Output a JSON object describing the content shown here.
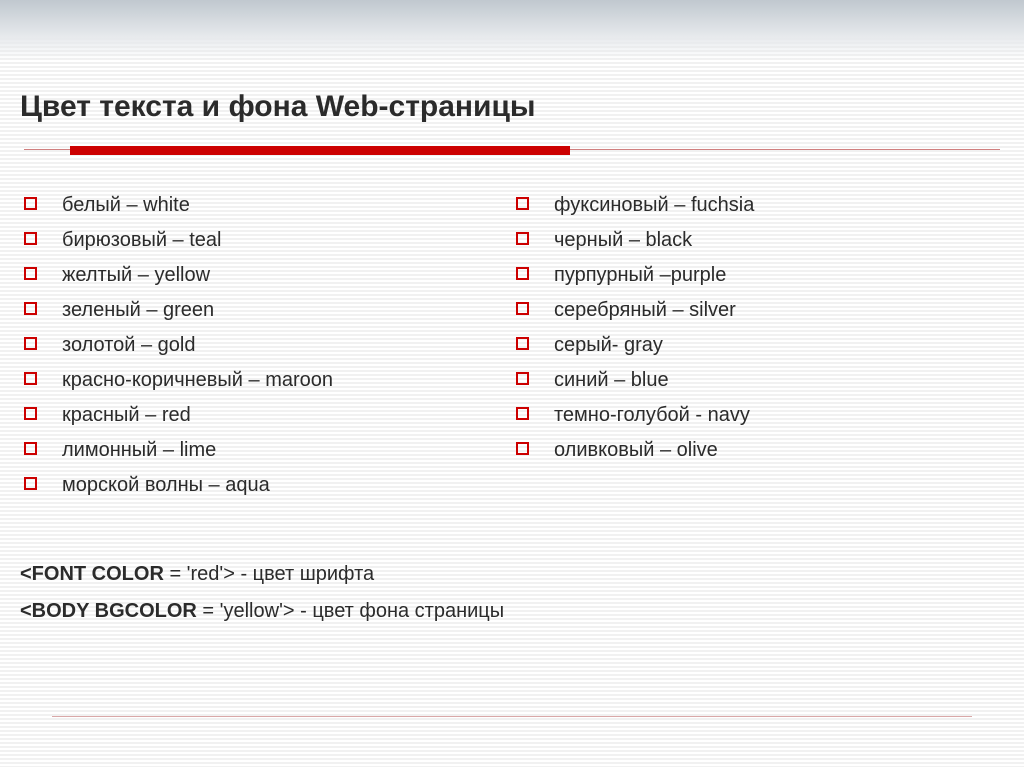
{
  "title": "Цвет текста и фона Web-страницы",
  "left_items": [
    "белый – white",
    "бирюзовый – teal",
    "желтый – yellow",
    "зеленый – green",
    "золотой – gold",
    " красно-коричневый – maroon",
    "красный – red",
    "лимонный – lime",
    "морской волны – aqua"
  ],
  "right_items": [
    "фуксиновый – fuchsia",
    "черный – black",
    "пурпурный –purple",
    "серебряный – silver",
    "серый- gray",
    "синий –  blue",
    "темно-голубой - navy",
    "оливковый – olive"
  ],
  "code1_tag": "<FONT COLOR",
  "code1_rest": " = 'red'> - цвет шрифта",
  "code2_tag": "<BODY BGCOLOR",
  "code2_rest": " = 'yellow'>  - цвет фона страницы"
}
